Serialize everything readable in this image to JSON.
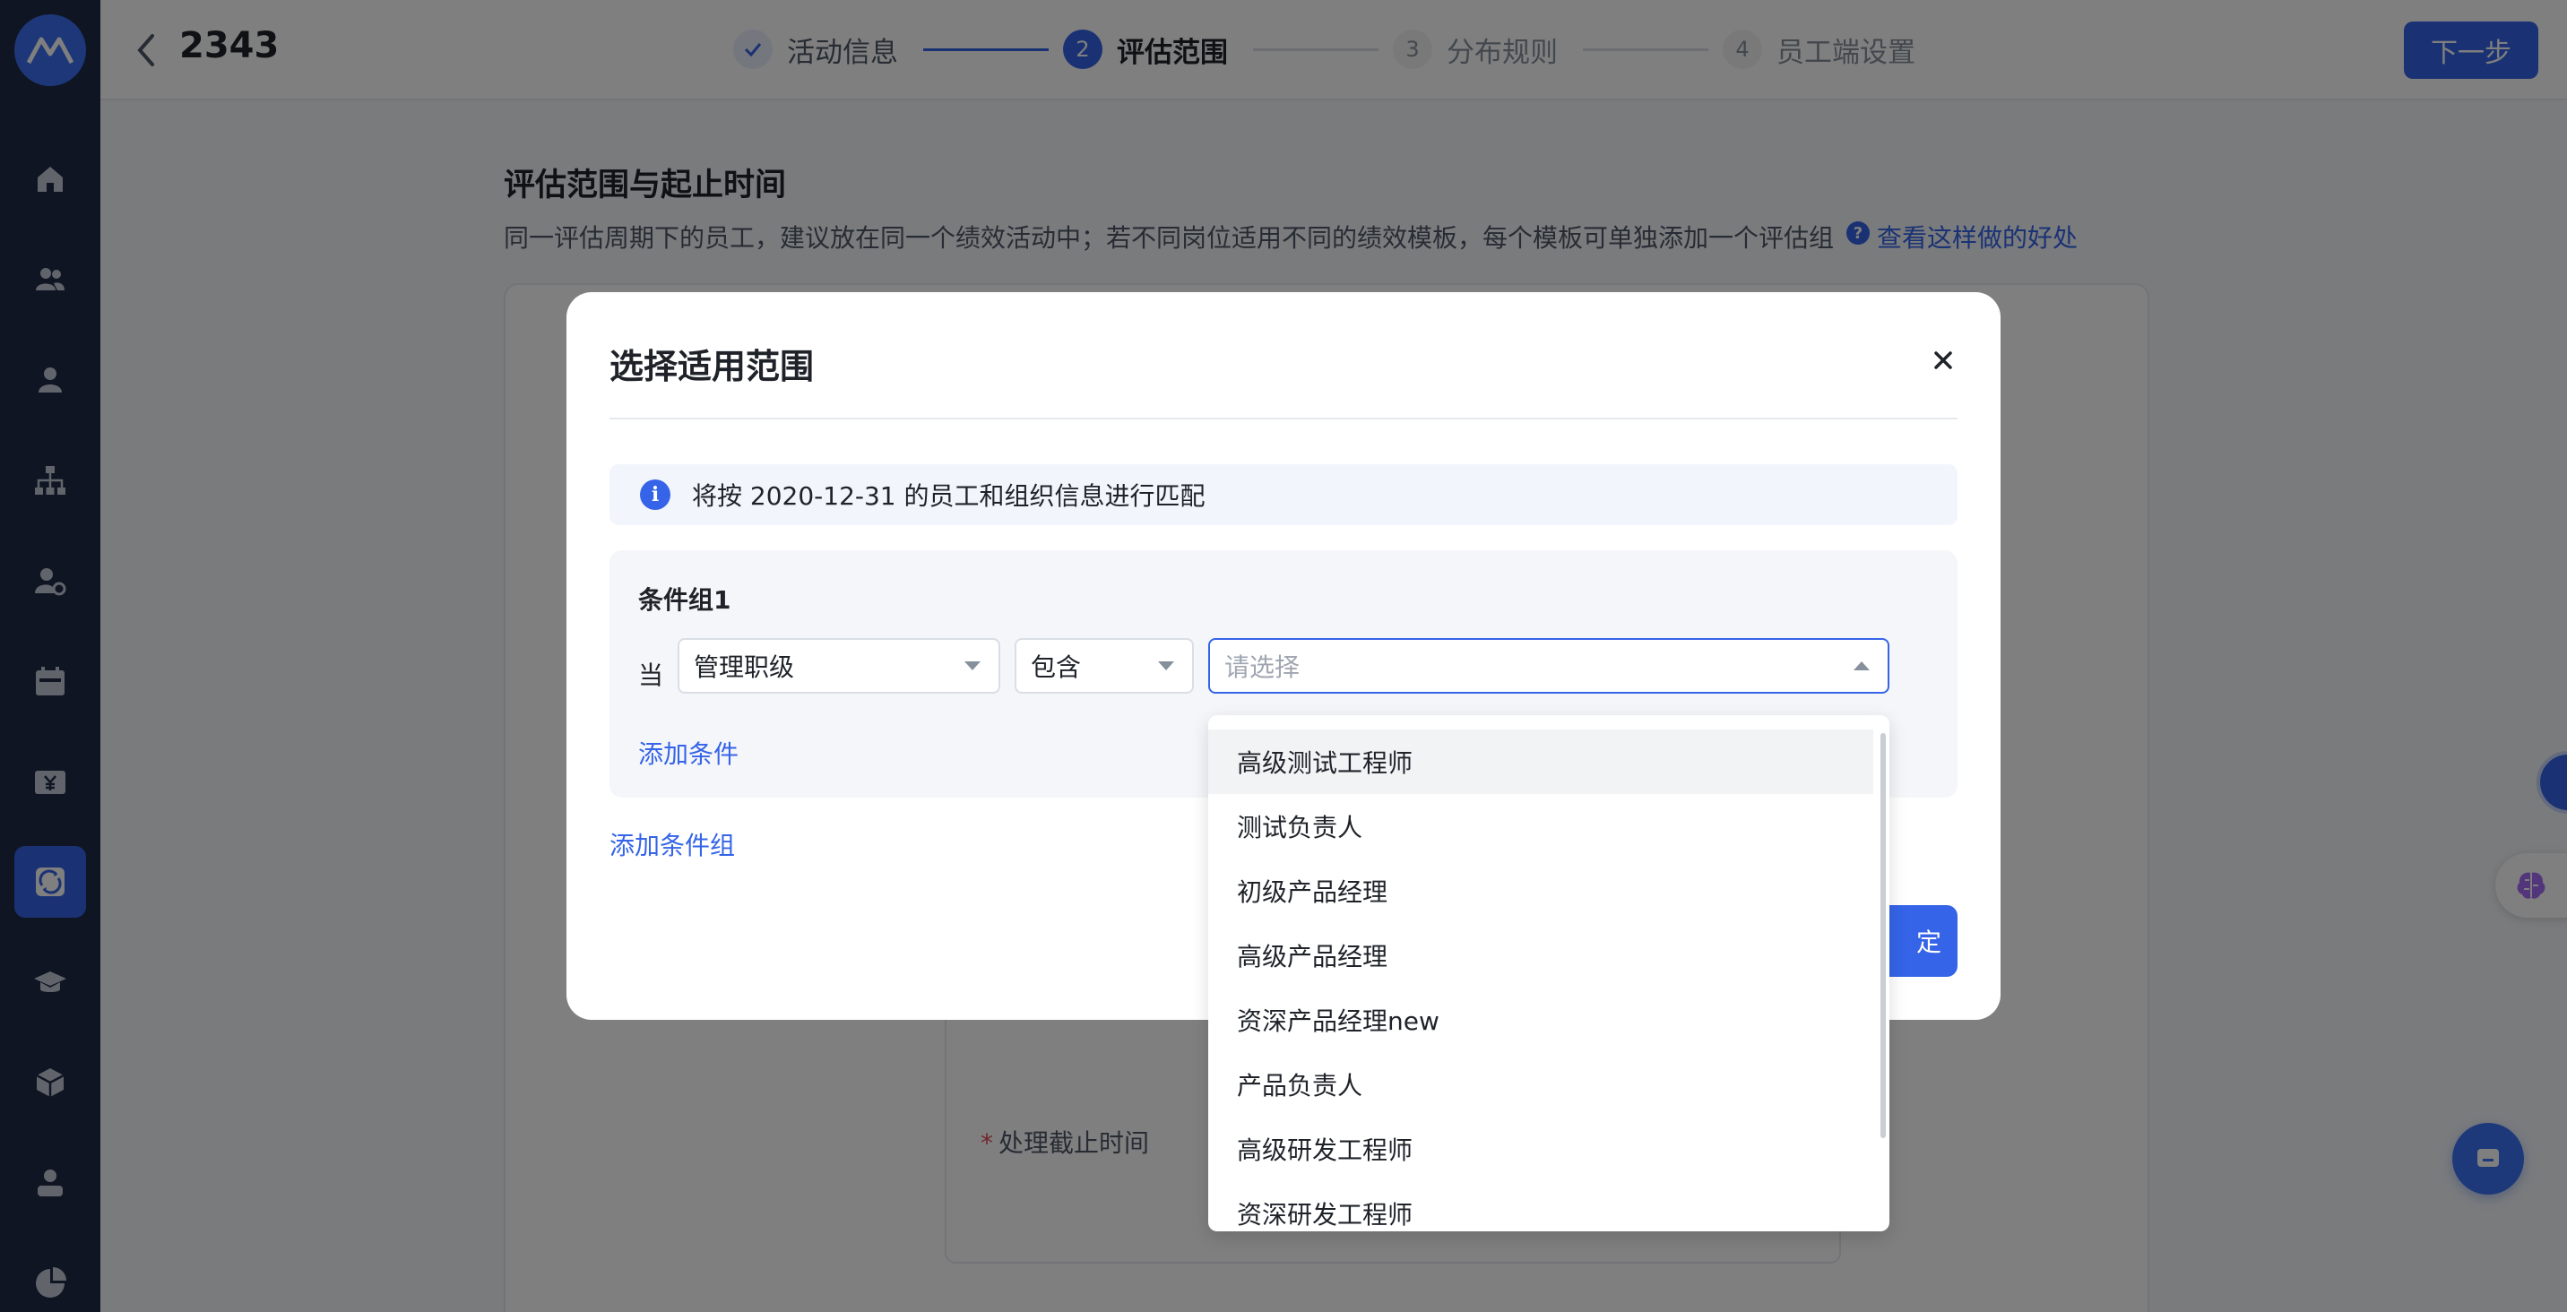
{
  "header": {
    "title": "2343",
    "next_label": "下一步"
  },
  "steps": [
    {
      "label": "活动信息",
      "state": "done",
      "number": ""
    },
    {
      "label": "评估范围",
      "state": "active",
      "number": "2"
    },
    {
      "label": "分布规则",
      "state": "todo",
      "number": "3"
    },
    {
      "label": "员工端设置",
      "state": "todo",
      "number": "4"
    }
  ],
  "content": {
    "section_title": "评估范围与起止时间",
    "section_desc": "同一评估周期下的员工，建议放在同一个绩效活动中；若不同岗位适用不同的绩效模板，每个模板可单独添加一个评估组",
    "help_link": "查看这样做的好处",
    "deadline_label": "处理截止时间"
  },
  "modal": {
    "title": "选择适用范围",
    "info_text": "将按 2020-12-31 的员工和组织信息进行匹配",
    "condition_group_title": "条件组1",
    "when_label": "当",
    "field_select_value": "管理职级",
    "operator_select_value": "包含",
    "value_select_placeholder": "请选择",
    "add_condition_label": "添加条件",
    "add_group_label": "添加条件组",
    "confirm_label": "定"
  },
  "dropdown": {
    "options": [
      "高级测试工程师",
      "测试负责人",
      "初级产品经理",
      "高级产品经理",
      "资深产品经理new",
      "产品负责人",
      "高级研发工程师",
      "资深研发工程师"
    ],
    "hovered_index": 0
  },
  "colors": {
    "sidebar": "#1e2a47",
    "accent": "#3564e8",
    "overlay": "rgba(0,0,0,0.5)"
  }
}
